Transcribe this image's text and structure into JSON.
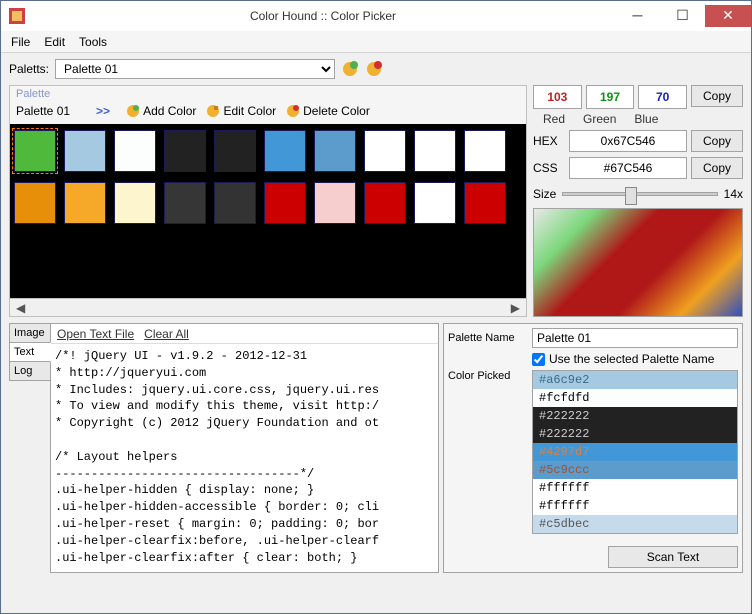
{
  "window": {
    "title": "Color Hound :: Color Picker"
  },
  "menu": {
    "file": "File",
    "edit": "Edit",
    "tools": "Tools"
  },
  "paletts": {
    "label": "Paletts:",
    "selected": "Palette 01"
  },
  "palette": {
    "group_title": "Palette",
    "name": "Palette 01",
    "arrows": ">>",
    "add": "Add Color",
    "edit": "Edit Color",
    "delete": "Delete Color",
    "row1": [
      "#4fb93b",
      "#a6c9e2",
      "#fcfdfd",
      "#222222",
      "#222222",
      "#4297d7",
      "#5c9ccc",
      "#ffffff",
      "#ffffff",
      "#ffffff"
    ],
    "row2": [
      "#e78f08",
      "#f6a828",
      "#fdf5ce",
      "#363636",
      "#333333",
      "#cc0000",
      "#f6cece",
      "#cc0000",
      "#ffffff",
      "#cc0000"
    ]
  },
  "rgb": {
    "r": "103",
    "g": "197",
    "b": "70",
    "labels": {
      "r": "Red",
      "g": "Green",
      "b": "Blue"
    },
    "copy": "Copy"
  },
  "hex": {
    "label": "HEX",
    "value": "0x67C546",
    "copy": "Copy"
  },
  "css": {
    "label": "CSS",
    "value": "#67C546",
    "copy": "Copy"
  },
  "size": {
    "label": "Size",
    "value": "14x"
  },
  "tabs": {
    "image": "Image",
    "text": "Text",
    "log": "Log"
  },
  "text_toolbar": {
    "open": "Open Text File",
    "clear": "Clear All"
  },
  "code": "/*! jQuery UI - v1.9.2 - 2012-12-31\n* http://jqueryui.com\n* Includes: jquery.ui.core.css, jquery.ui.res\n* To view and modify this theme, visit http:/\n* Copyright (c) 2012 jQuery Foundation and ot\n\n/* Layout helpers\n----------------------------------*/\n.ui-helper-hidden { display: none; }\n.ui-helper-hidden-accessible { border: 0; cli\n.ui-helper-reset { margin: 0; padding: 0; bor\n.ui-helper-clearfix:before, .ui-helper-clearf\n.ui-helper-clearfix:after { clear: both; }",
  "right": {
    "palette_name_label": "Palette Name",
    "palette_name": "Palette 01",
    "use_selected": "Use the selected Palette Name",
    "color_picked_label": "Color Picked",
    "picked": [
      {
        "hex": "#a6c9e2",
        "bg": "#a6c9e2",
        "fg": "#3a6a8a"
      },
      {
        "hex": "#fcfdfd",
        "bg": "#fcfdfd",
        "fg": "#000"
      },
      {
        "hex": "#222222",
        "bg": "#222222",
        "fg": "#ccc"
      },
      {
        "hex": "#222222",
        "bg": "#222222",
        "fg": "#ccc"
      },
      {
        "hex": "#4297d7",
        "bg": "#4297d7",
        "fg": "#d0844a"
      },
      {
        "hex": "#5c9ccc",
        "bg": "#5c9ccc",
        "fg": "#a05030"
      },
      {
        "hex": "#ffffff",
        "bg": "#ffffff",
        "fg": "#000"
      },
      {
        "hex": "#ffffff",
        "bg": "#ffffff",
        "fg": "#000"
      },
      {
        "hex": "#c5dbec",
        "bg": "#c5dbec",
        "fg": "#555"
      }
    ],
    "scan": "Scan Text"
  }
}
